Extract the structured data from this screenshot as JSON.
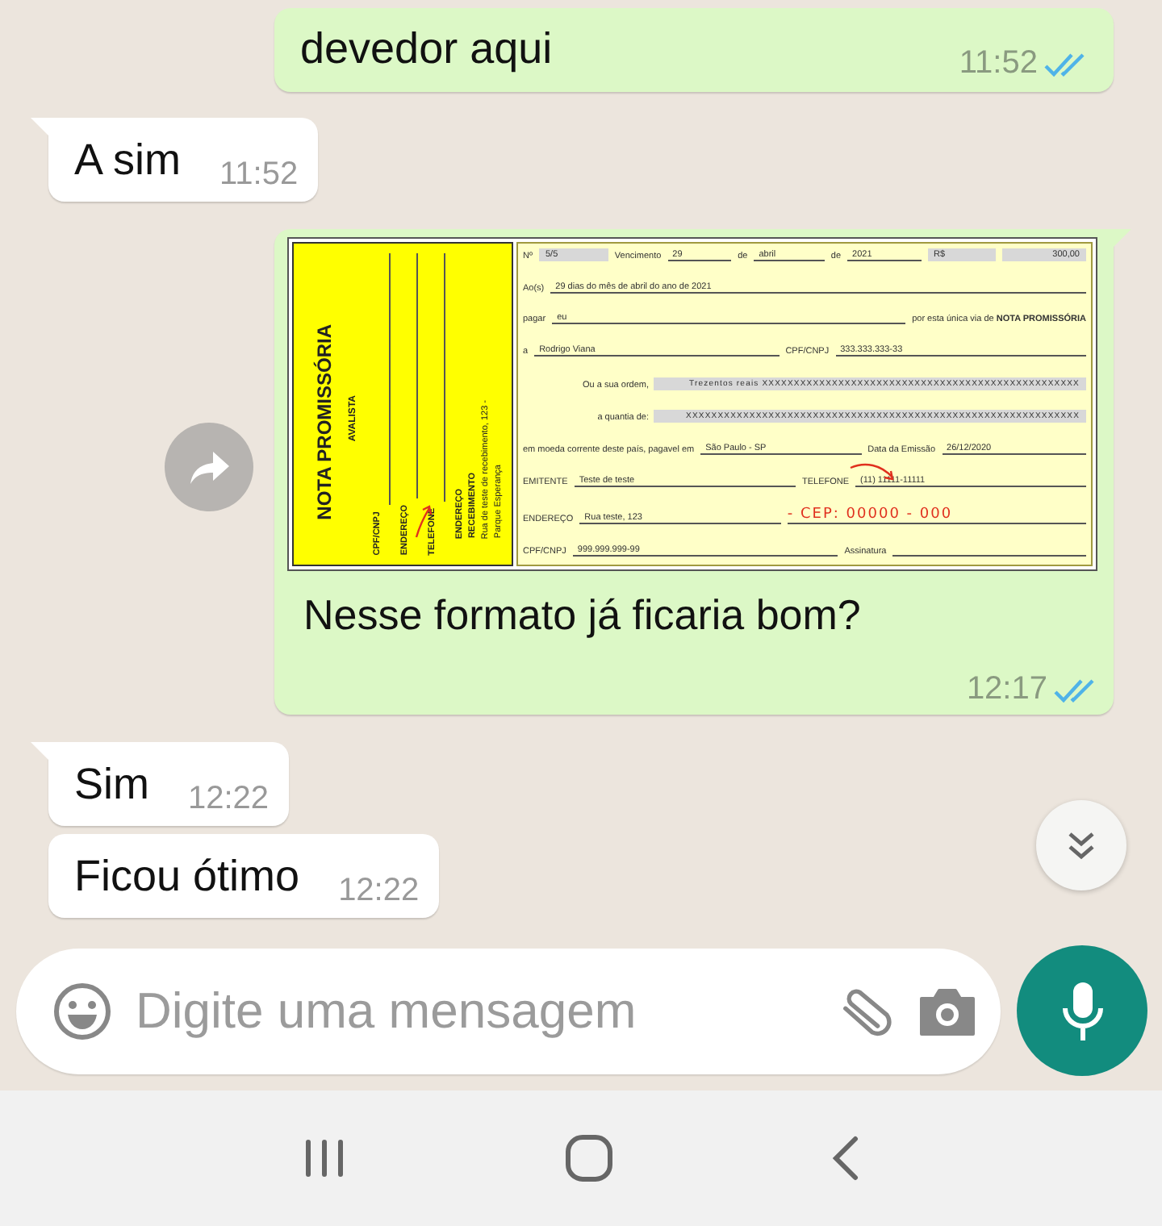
{
  "messages": [
    {
      "outgoing": true,
      "tail": false,
      "text": "devedor aqui",
      "time": "11:52",
      "read": true
    },
    {
      "outgoing": false,
      "tail": true,
      "text": "A sim",
      "time": "11:52"
    },
    {
      "outgoing": true,
      "tail": true,
      "kind": "image",
      "caption": "Nesse formato já ficaria bom?",
      "time": "12:17",
      "read": true,
      "document": {
        "stub": {
          "title": "NOTA PROMISSÓRIA",
          "subtitle": "AVALISTA",
          "fields": [
            "CPF/CNPJ",
            "ENDEREÇO",
            "TELEFONE"
          ],
          "address_label": [
            "ENDEREÇO",
            "RECEBIMENTO"
          ],
          "address": [
            "Rua de teste de recebimento, 123 -",
            "Parque Esperança"
          ]
        },
        "rows": [
          {
            "kind": "line",
            "items": [
              {
                "kind": "label",
                "text": "Nº"
              },
              {
                "kind": "box",
                "text": "5/5"
              },
              {
                "kind": "label",
                "text": "Vencimento"
              },
              {
                "kind": "value",
                "text": "29"
              },
              {
                "kind": "label",
                "text": "de"
              },
              {
                "kind": "value",
                "text": "abril"
              },
              {
                "kind": "label",
                "text": "de"
              },
              {
                "kind": "value",
                "text": "2021"
              },
              {
                "kind": "box",
                "text": "R$"
              },
              {
                "kind": "box",
                "text": "300,00"
              }
            ]
          },
          {
            "kind": "line",
            "items": [
              {
                "kind": "label",
                "text": "Ao(s)"
              },
              {
                "kind": "value",
                "text": "29 dias do mês de abril  do ano de 2021"
              }
            ]
          },
          {
            "kind": "line",
            "items": [
              {
                "kind": "label",
                "text": "pagar"
              },
              {
                "kind": "value",
                "text": "eu"
              },
              {
                "kind": "label",
                "text": "por esta única via de **NOTA PROMISSÓRIA**"
              }
            ]
          },
          {
            "kind": "line",
            "items": [
              {
                "kind": "label",
                "text": "a"
              },
              {
                "kind": "value",
                "text": "Rodrigo Viana"
              },
              {
                "kind": "label",
                "text": "CPF/CNPJ"
              },
              {
                "kind": "value",
                "text": "333.333.333-33"
              }
            ]
          },
          {
            "kind": "amount",
            "items": [
              {
                "kind": "label",
                "text": "Ou a sua ordem,"
              },
              {
                "kind": "box",
                "text": "Trezentos reais XXXXXXXXXXXXXXXXXXXXXXXXXXXXXXXXXXXXXXXXXXXXXXXXXX"
              }
            ]
          },
          {
            "kind": "amount",
            "items": [
              {
                "kind": "label",
                "text": "a quantia de:"
              },
              {
                "kind": "box",
                "text": "XXXXXXXXXXXXXXXXXXXXXXXXXXXXXXXXXXXXXXXXXXXXXXXXXXXXXXXXXXXXXX"
              }
            ]
          },
          {
            "kind": "line",
            "items": [
              {
                "kind": "label",
                "text": "em moeda corrente deste país, pagavel em"
              },
              {
                "kind": "value",
                "text": "São Paulo - SP"
              },
              {
                "kind": "label",
                "text": "Data da Emissão"
              },
              {
                "kind": "value",
                "text": "26/12/2020"
              }
            ]
          },
          {
            "kind": "line",
            "items": [
              {
                "kind": "label",
                "text": "EMITENTE"
              },
              {
                "kind": "value",
                "text": "Teste de teste"
              },
              {
                "kind": "label",
                "text": "TELEFONE"
              },
              {
                "kind": "value",
                "text": "(11) 11111-11111"
              }
            ]
          },
          {
            "kind": "line",
            "items": [
              {
                "kind": "label",
                "text": "ENDEREÇO"
              },
              {
                "kind": "value",
                "text": "Rua teste, 123"
              },
              {
                "kind": "hand",
                "text": "- CEP: 00000 - 000"
              }
            ]
          },
          {
            "kind": "signature",
            "items": [
              {
                "kind": "label",
                "text": "CPF/CNPJ"
              },
              {
                "kind": "value",
                "text": "999.999.999-99"
              },
              {
                "kind": "label",
                "text": "Assinatura"
              }
            ]
          }
        ]
      }
    },
    {
      "outgoing": false,
      "tail": true,
      "text": "Sim",
      "time": "12:22"
    },
    {
      "outgoing": false,
      "tail": false,
      "text": "Ficou ótimo",
      "time": "12:22"
    }
  ],
  "composer": {
    "placeholder": "Digite uma mensagem"
  }
}
